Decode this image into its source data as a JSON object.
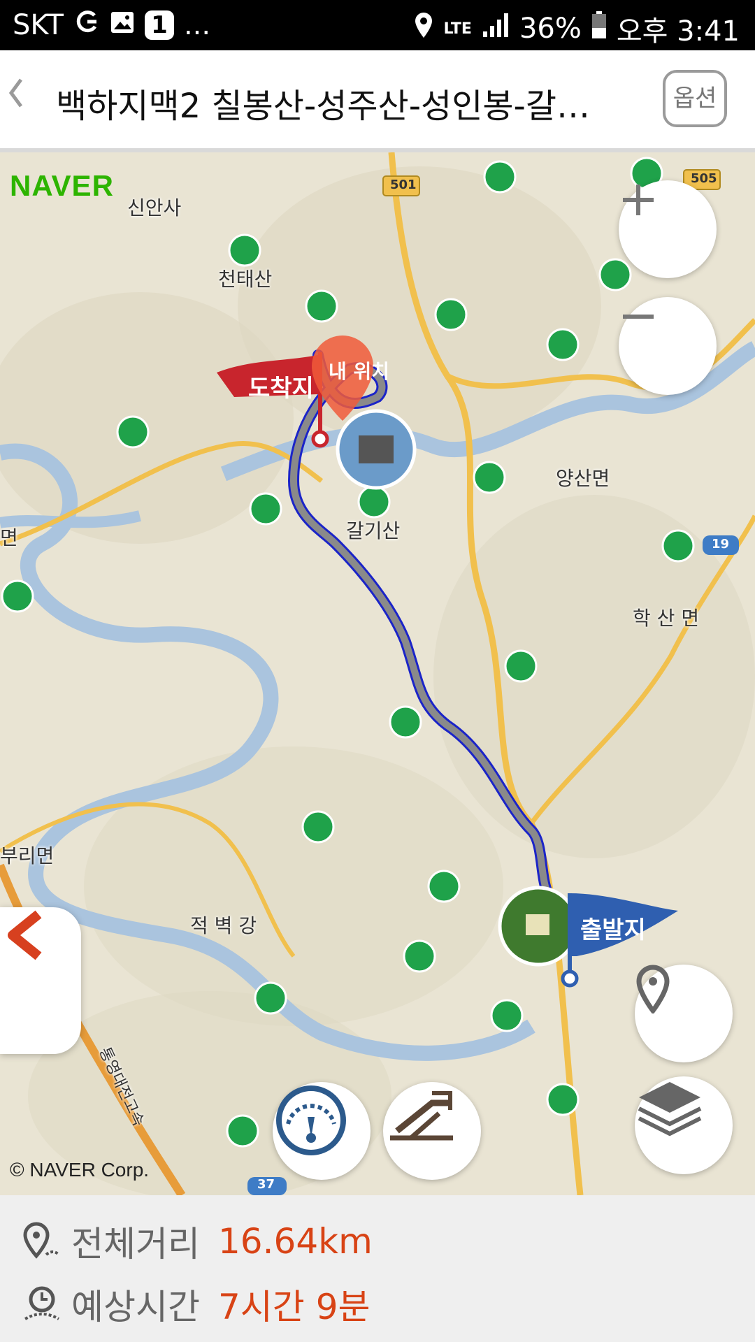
{
  "status_bar": {
    "carrier": "SKT",
    "notification_count": "1",
    "more": "...",
    "network": "LTE",
    "battery": "36%",
    "time": "오후 3:41"
  },
  "header": {
    "back_icon": "chevron-left-icon",
    "title": "백하지맥2 칠봉산-성주산-성인봉-갈…",
    "option_label": "옵션"
  },
  "map": {
    "logo": "NAVER",
    "copyright": "© NAVER Corp.",
    "labels": {
      "place_1": "신안사",
      "place_2": "천태산",
      "place_3": "갈기산",
      "place_4": "양산면",
      "place_5": "학 산 면",
      "place_6": "적 벽 강",
      "place_7": "부리면",
      "place_8": "면",
      "place_9": "통영대전고속"
    },
    "road_numbers": {
      "r1": "501",
      "r2": "505",
      "r3": "19",
      "r4": "37"
    },
    "flags": {
      "arrival": "도착지",
      "departure": "출발지"
    },
    "current_location": "내 위치",
    "colors": {
      "route": "#1b24c8",
      "route_fill": "#8a8a8a",
      "arrival_flag": "#c8252d",
      "departure_flag": "#2f5fb0",
      "mountain_marker": "#1fa24a"
    },
    "controls": {
      "zoom_in": "plus-icon",
      "zoom_out": "minus-icon",
      "locate": "location-pin-icon",
      "layers": "layers-icon",
      "panel_toggle": "chevron-left-icon",
      "speedometer": "speedometer-icon",
      "elevation": "elevation-icon"
    }
  },
  "summary": {
    "distance_label": "전체거리",
    "distance_value": "16.64km",
    "time_label": "예상시간",
    "time_value": "7시간 9분"
  }
}
